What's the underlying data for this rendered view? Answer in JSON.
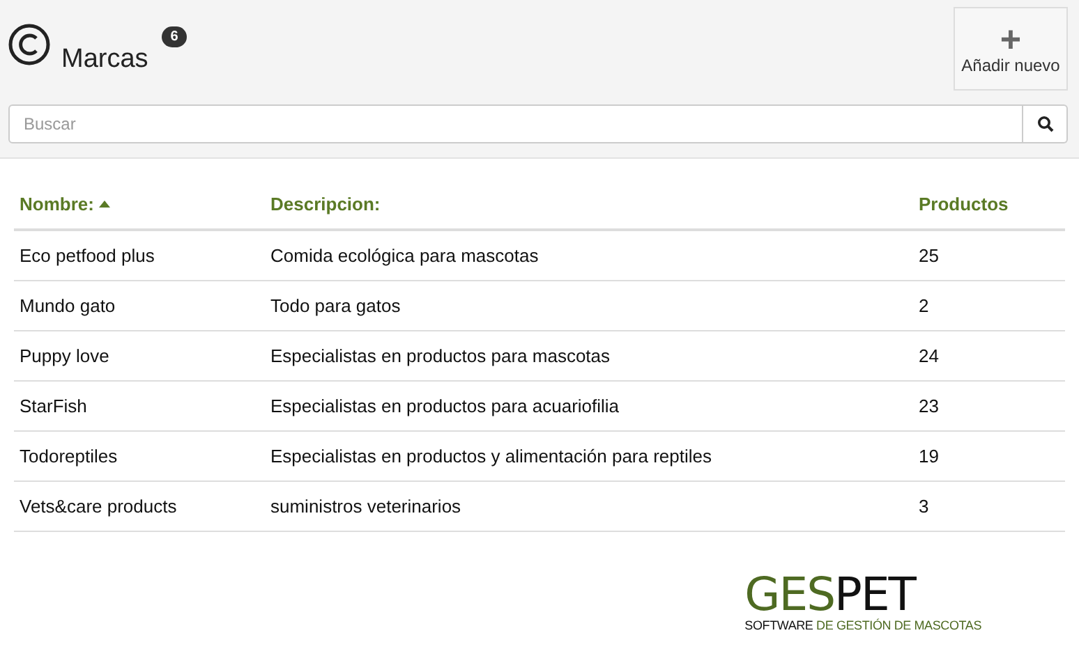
{
  "header": {
    "title": "Marcas",
    "count": "6",
    "add_button": {
      "icon": "+",
      "label": "Añadir nuevo"
    }
  },
  "search": {
    "placeholder": "Buscar"
  },
  "table": {
    "columns": [
      {
        "label": "Nombre:",
        "sorted": true
      },
      {
        "label": "Descripcion:",
        "sorted": false
      },
      {
        "label": "Productos",
        "sorted": false
      }
    ],
    "rows": [
      [
        "Eco petfood plus",
        "Comida ecológica para mascotas",
        "25"
      ],
      [
        "Mundo gato",
        "Todo para gatos",
        "2"
      ],
      [
        "Puppy love",
        "Especialistas en productos para mascotas",
        "24"
      ],
      [
        "StarFish",
        "Especialistas en productos para acuariofilia",
        "23"
      ],
      [
        "Todoreptiles",
        "Especialistas en productos y alimentación para reptiles",
        "19"
      ],
      [
        "Vets&care products",
        "suministros veterinarios",
        "3"
      ]
    ]
  },
  "logo": {
    "name": [
      {
        "text": "GES",
        "highlight": true
      },
      {
        "text": "PET",
        "highlight": false
      }
    ],
    "tagline": [
      {
        "text": "SOFTWARE",
        "highlight": false
      },
      {
        "text": "DE GESTIÓN DE MASCOTAS",
        "highlight": true
      }
    ]
  }
}
